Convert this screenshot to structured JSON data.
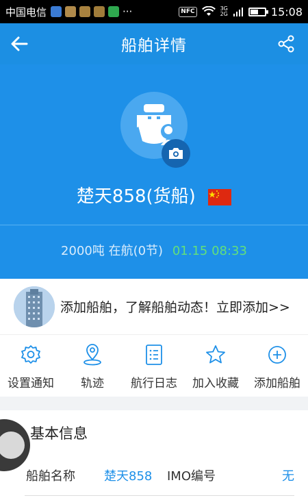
{
  "status_bar": {
    "carrier": "中国电信",
    "dots": "···",
    "nfc": "NFC",
    "network_top": "3G",
    "network_bottom": "2G",
    "time": "15:08",
    "battery_level": 0.55
  },
  "nav": {
    "title": "船舶详情"
  },
  "ship": {
    "name": "楚天858(货船)",
    "flag_country": "China",
    "summary": "2000吨 在航(0节)",
    "update_time": "01.15 08:33"
  },
  "promo": {
    "text": "添加船舶，了解船舶动态！立即添加>>"
  },
  "actions": [
    {
      "label": "设置通知",
      "icon": "settings-icon"
    },
    {
      "label": "轨迹",
      "icon": "location-pin-icon"
    },
    {
      "label": "航行日志",
      "icon": "log-list-icon"
    },
    {
      "label": "加入收藏",
      "icon": "star-icon"
    },
    {
      "label": "添加船舶",
      "icon": "add-circle-icon"
    }
  ],
  "basic_info": {
    "section_title": "基本信息",
    "ship_name_label": "船舶名称",
    "ship_name_value": "楚天858",
    "imo_label": "IMO编号",
    "imo_value": "无"
  },
  "colors": {
    "primary": "#1e90e8",
    "title_bar": "#1c8fe3",
    "accent_green": "#63e07a",
    "link_blue": "#1e90e8"
  }
}
